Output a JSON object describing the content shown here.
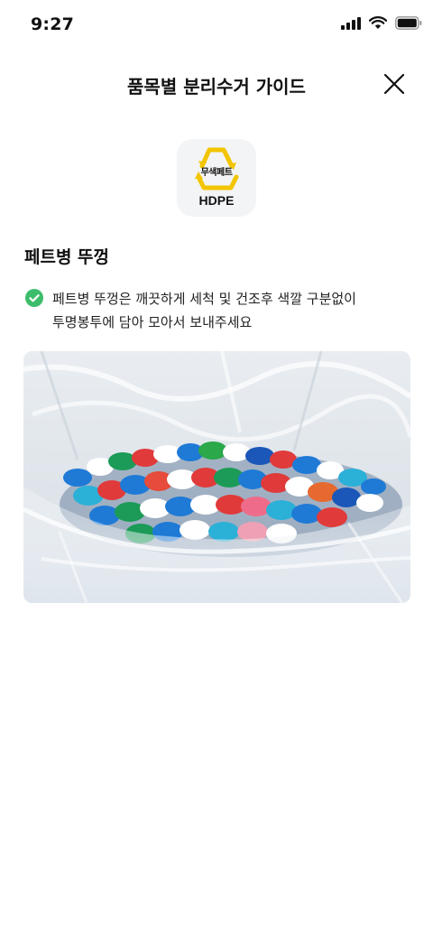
{
  "status_bar": {
    "time": "9:27"
  },
  "header": {
    "title": "품목별 분리수거 가이드",
    "close_icon": "close-icon"
  },
  "badge": {
    "korean_label": "무색페트",
    "code": "HDPE",
    "accent_color": "#f2c500"
  },
  "section": {
    "title": "페트병 뚜껑",
    "guide": {
      "icon": "check-circle-icon",
      "icon_color": "#3dbd6b",
      "line1": "페트병 뚜껑은 깨끗하게 세척 및 건조후 색깔 구분없이",
      "line2": "투명봉투에 담아 모아서 보내주세요"
    }
  },
  "photo": {
    "subject": "plastic-bottle-caps-in-clear-bag"
  }
}
